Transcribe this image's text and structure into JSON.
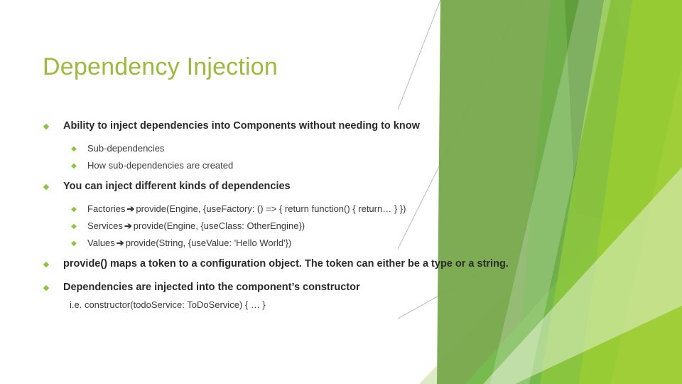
{
  "slide": {
    "title": "Dependency Injection",
    "title_color": "#9BBB3C",
    "background_color": "#FFFFFF",
    "accent_color": "#8CC63E"
  },
  "bullets": {
    "marker_glyph": "◆",
    "arrow_glyph": "➔",
    "b1": "Ability to inject dependencies into Components without needing to know",
    "b1s1": "Sub-dependencies",
    "b1s2": "How sub-dependencies are created",
    "b2": "You can inject different kinds of dependencies",
    "b2s1_label": "Factories",
    "b2s1_code": "provide(Engine, {useFactory: () => { return function() { return… } })",
    "b2s2_label": "Services",
    "b2s2_code": "provide(Engine, {useClass: OtherEngine})",
    "b2s3_label": "Values",
    "b2s3_code": "provide(String, {useValue: 'Hello World'})",
    "b3": "provide() maps a token to a configuration object. The token can either be a type or a string.",
    "b4": "Dependencies are injected into the component’s constructor",
    "b4_note": "i.e. constructor(todoService: ToDoService) { … }"
  },
  "decoration": {
    "name": "angular-green-facets",
    "colors": {
      "bright_green": "#8DC63F",
      "lime_green": "#9ACD32",
      "olive_green": "#76A84C",
      "mid_green": "#76BB4E",
      "deep_green": "#5E9B3A",
      "pale_green": "#DDEBC4",
      "pale_green_2": "#C8DFA2",
      "hairline": "#B8B8B8"
    }
  }
}
